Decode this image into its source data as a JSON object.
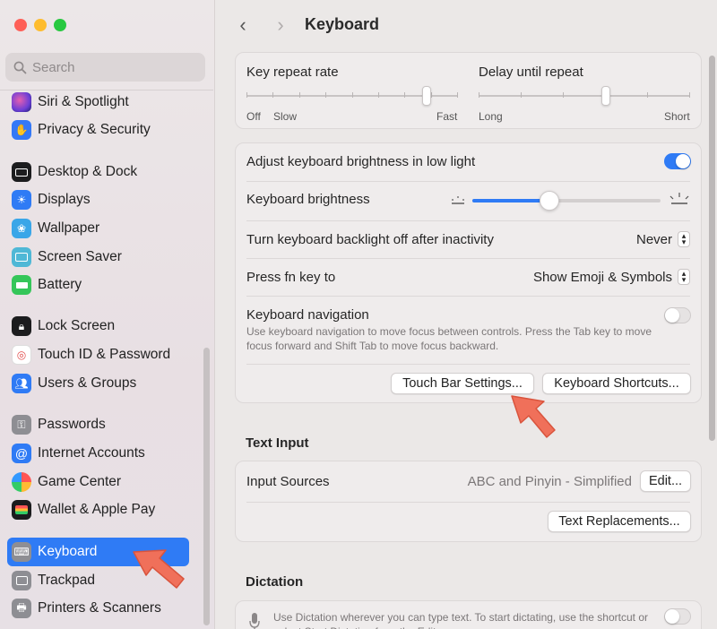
{
  "sidebar": {
    "search_placeholder": "Search",
    "items": [
      {
        "label": "Siri & Spotlight",
        "icon": "siri-icon",
        "color": "#6d3fd6"
      },
      {
        "label": "Privacy & Security",
        "icon": "hand-icon",
        "color": "#3478f6"
      },
      {
        "label": "Desktop & Dock",
        "icon": "dock-icon",
        "color": "#1c1c1e"
      },
      {
        "label": "Displays",
        "icon": "sun-icon",
        "color": "#2f7bf5"
      },
      {
        "label": "Wallpaper",
        "icon": "flower-icon",
        "color": "#3aa6e8"
      },
      {
        "label": "Screen Saver",
        "icon": "screen-saver-icon",
        "color": "#4fb8d6"
      },
      {
        "label": "Battery",
        "icon": "battery-icon",
        "color": "#35c659"
      },
      {
        "label": "Lock Screen",
        "icon": "lock-icon",
        "color": "#1c1c1e"
      },
      {
        "label": "Touch ID & Password",
        "icon": "fingerprint-icon",
        "color": "#ffffff"
      },
      {
        "label": "Users & Groups",
        "icon": "users-icon",
        "color": "#2f7bf5"
      },
      {
        "label": "Passwords",
        "icon": "key-icon",
        "color": "#8e8e93"
      },
      {
        "label": "Internet Accounts",
        "icon": "at-icon",
        "color": "#2f7bf5"
      },
      {
        "label": "Game Center",
        "icon": "game-center-icon",
        "color": "#ffffff"
      },
      {
        "label": "Wallet & Apple Pay",
        "icon": "wallet-icon",
        "color": "#1c1c1e"
      },
      {
        "label": "Keyboard",
        "icon": "keyboard-icon",
        "color": "#8e8e93"
      },
      {
        "label": "Trackpad",
        "icon": "trackpad-icon",
        "color": "#8e8e93"
      },
      {
        "label": "Printers & Scanners",
        "icon": "printer-icon",
        "color": "#8e8e93"
      }
    ],
    "active": "Keyboard"
  },
  "toolbar": {
    "back": "‹",
    "forward": "›",
    "title": "Keyboard"
  },
  "repeat": {
    "key_repeat_label": "Key repeat rate",
    "key_repeat_off": "Off",
    "key_repeat_slow": "Slow",
    "key_repeat_fast": "Fast",
    "key_repeat_level": 0.85,
    "delay_label": "Delay until repeat",
    "delay_long": "Long",
    "delay_short": "Short",
    "delay_level": 0.6
  },
  "settings": {
    "adjust_brightness_label": "Adjust keyboard brightness in low light",
    "adjust_brightness_on": true,
    "brightness_label": "Keyboard brightness",
    "brightness_level": 0.41,
    "backlight_off_label": "Turn keyboard backlight off after inactivity",
    "backlight_off_value": "Never",
    "fn_key_label": "Press fn key to",
    "fn_key_value": "Show Emoji & Symbols",
    "nav_label": "Keyboard navigation",
    "nav_desc": "Use keyboard navigation to move focus between controls. Press the Tab key to move focus forward and Shift Tab to move focus backward.",
    "nav_on": false,
    "touch_bar_button": "Touch Bar Settings...",
    "shortcuts_button": "Keyboard Shortcuts..."
  },
  "text_input": {
    "section_title": "Text Input",
    "input_sources_label": "Input Sources",
    "input_sources_value": "ABC and Pinyin - Simplified",
    "edit_button": "Edit...",
    "replacements_button": "Text Replacements..."
  },
  "dictation": {
    "section_title": "Dictation",
    "desc": "Use Dictation wherever you can type text. To start dictating, use the shortcut or select Start Dictation from the Edit menu.",
    "on": false
  },
  "colors": {
    "accent": "#2f7bf5",
    "arrow": "#f0705a"
  }
}
